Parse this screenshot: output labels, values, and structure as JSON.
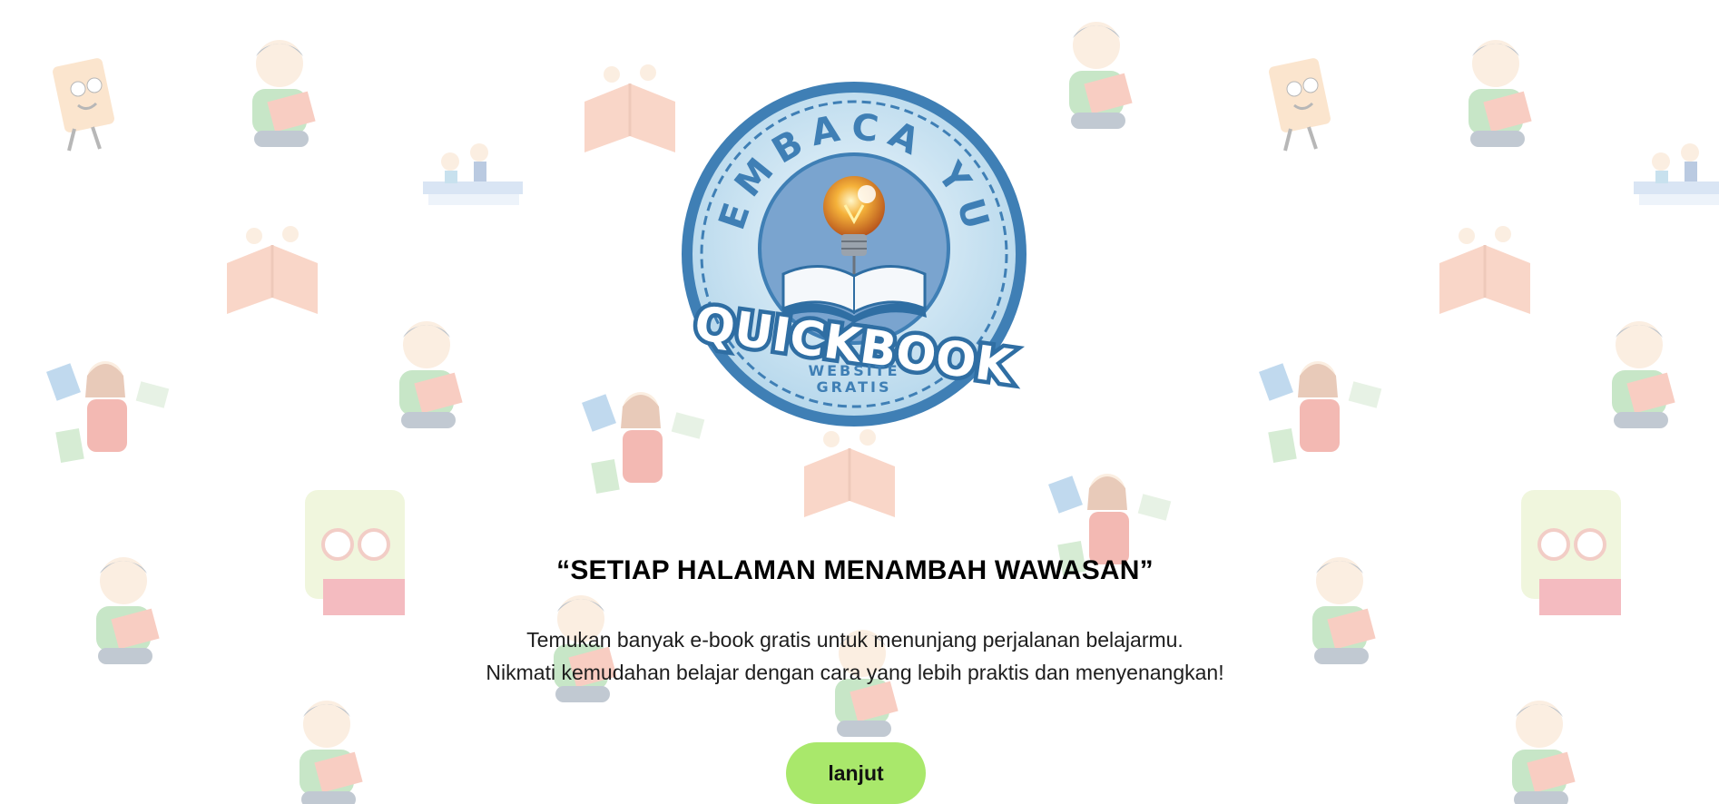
{
  "logo": {
    "arc_text": "MEMBACA YUK",
    "brand": "QUICKBOOK",
    "sub_line1": "WEBSITE",
    "sub_line2": "GRATIS"
  },
  "hero": {
    "headline": "“SETIAP HALAMAN MENAMBAH WAWASAN”",
    "description_line1": "Temukan banyak e-book gratis untuk menunjang perjalanan belajarmu.",
    "description_line2": "Nikmati kemudahan belajar dengan cara yang lebih praktis dan menyenangkan!"
  },
  "cta": {
    "label": "lanjut"
  },
  "colors": {
    "button_bg": "#a9e86b",
    "logo_blue": "#3f7fb5",
    "logo_light": "#d8ecf6"
  },
  "icons": {
    "background_pattern": "children-reading-books-pattern",
    "logo_bulb": "lightbulb-icon",
    "logo_book": "open-book-icon"
  }
}
